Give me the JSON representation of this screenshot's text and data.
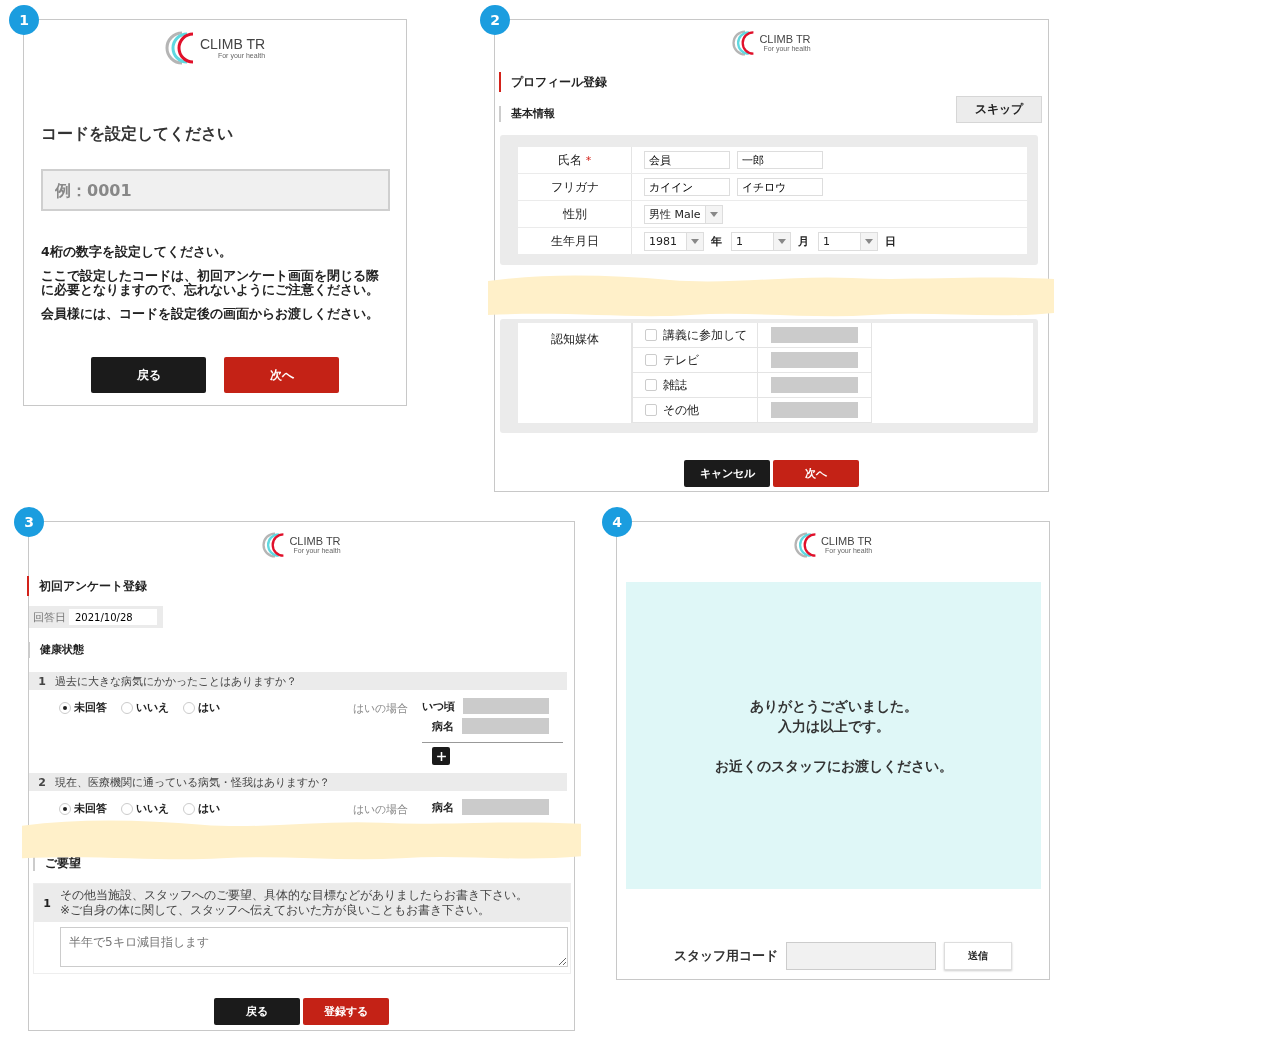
{
  "panels": [
    {
      "kind": "code_setup",
      "badge": "1",
      "logo": {
        "name": "CLIMB TR",
        "tagline": "For your health"
      },
      "heading": "コードを設定してください",
      "code_field": {
        "placeholder": "例：0001"
      },
      "paragraphs": [
        "4桁の数字を設定してください。",
        "ここで設定したコードは、初回アンケート画面を閉じる際に必要となりますので、忘れないようにご注意ください。",
        "会員様には、コードを設定後の画面からお渡しください。"
      ],
      "buttons": [
        {
          "label": "戻る",
          "kind": "dark"
        },
        {
          "label": "次へ",
          "kind": "primary"
        }
      ]
    },
    {
      "kind": "profile",
      "badge": "2",
      "logo": {
        "name": "CLIMB TR",
        "tagline": "For your health"
      },
      "title": "プロフィール登録",
      "skip_button": "スキップ",
      "section": "基本情報",
      "rows": [
        {
          "kind": "text_pair",
          "label": "氏名",
          "required_mark": "*",
          "values": [
            "会員",
            "一郎"
          ]
        },
        {
          "kind": "text_pair",
          "label": "フリガナ",
          "values": [
            "カイイン",
            "イチロウ"
          ]
        },
        {
          "kind": "select",
          "label": "性別",
          "value": "男性 Male"
        },
        {
          "kind": "date",
          "label": "生年月日",
          "parts": [
            {
              "value": "1981",
              "unit": "年"
            },
            {
              "value": "1",
              "unit": "月"
            },
            {
              "value": "1",
              "unit": "日"
            }
          ]
        }
      ],
      "media": {
        "label": "認知媒体",
        "options": [
          {
            "label": "講義に参加して",
            "checked": false
          },
          {
            "label": "テレビ",
            "checked": false
          },
          {
            "label": "雑誌",
            "checked": false
          },
          {
            "label": "その他",
            "checked": false
          }
        ]
      },
      "buttons": [
        {
          "label": "キャンセル",
          "kind": "dark"
        },
        {
          "label": "次へ",
          "kind": "primary"
        }
      ]
    },
    {
      "kind": "survey",
      "badge": "3",
      "logo": {
        "name": "CLIMB TR",
        "tagline": "For your health"
      },
      "title": "初回アンケート登録",
      "answer_date": {
        "label": "回答日",
        "value": "2021/10/28"
      },
      "section": "健康状態",
      "questions": [
        {
          "number": "1",
          "text": "過去に大きな病気にかかったことはありますか？",
          "options": [
            {
              "label": "未回答",
              "selected": true
            },
            {
              "label": "いいえ",
              "selected": false
            },
            {
              "label": "はい",
              "selected": false
            }
          ],
          "condition": "はいの場合",
          "fields": [
            "いつ頃",
            "病名"
          ],
          "add_button": true
        },
        {
          "number": "2",
          "text": "現在、医療機関に通っている病気・怪我はありますか？",
          "options": [
            {
              "label": "未回答",
              "selected": true
            },
            {
              "label": "いいえ",
              "selected": false
            },
            {
              "label": "はい",
              "selected": false
            }
          ],
          "condition": "はいの場合",
          "fields": [
            "病名"
          ],
          "add_button": false
        }
      ],
      "request_section": "ご要望",
      "request": {
        "number": "1",
        "lines": [
          "その他当施設、スタッフへのご要望、具体的な目標などがありましたらお書き下さい。",
          "※ご自身の体に関して、スタッフへ伝えておいた方が良いこともお書き下さい。"
        ],
        "placeholder": "半年で5キロ減目指します"
      },
      "buttons": [
        {
          "label": "戻る",
          "kind": "dark"
        },
        {
          "label": "登録する",
          "kind": "primary"
        }
      ]
    },
    {
      "kind": "complete",
      "badge": "4",
      "logo": {
        "name": "CLIMB TR",
        "tagline": "For your health"
      },
      "message_groups": [
        [
          "ありがとうございました。",
          "入力は以上です。"
        ],
        [
          "お近くのスタッフにお渡しください。"
        ]
      ],
      "staff_code": {
        "label": "スタッフ用コード"
      },
      "submit_button": "送信"
    }
  ]
}
